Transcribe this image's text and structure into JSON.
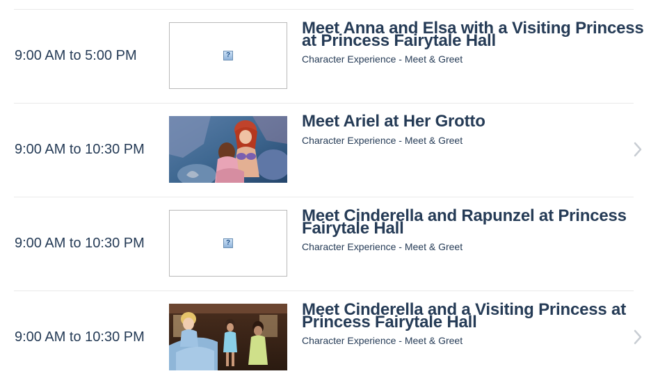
{
  "events": [
    {
      "time": "9:00 AM to 5:00 PM",
      "title": "Meet Anna and Elsa with a Visiting Princess at Princess Fairytale Hall",
      "subtitle": "Character Experience - Meet & Greet",
      "image": "broken-image",
      "chevron": false
    },
    {
      "time": "9:00 AM to 10:30 PM",
      "title": "Meet Ariel at Her Grotto",
      "subtitle": "Character Experience - Meet & Greet",
      "image": "photo-ariel-grotto",
      "chevron": true
    },
    {
      "time": "9:00 AM to 10:30 PM",
      "title": "Meet Cinderella and Rapunzel at Princess Fairytale Hall",
      "subtitle": "Character Experience - Meet & Greet",
      "image": "broken-image",
      "chevron": false
    },
    {
      "time": "9:00 AM to 10:30 PM",
      "title": "Meet Cinderella and a Visiting Princess at Princess Fairytale Hall",
      "subtitle": "Character Experience - Meet & Greet",
      "image": "photo-cinderella",
      "chevron": true
    }
  ],
  "broken_image_glyph": "?",
  "colors": {
    "text": "#253b56",
    "divider": "#e9e9e9",
    "chevron": "#c8cdd3"
  }
}
